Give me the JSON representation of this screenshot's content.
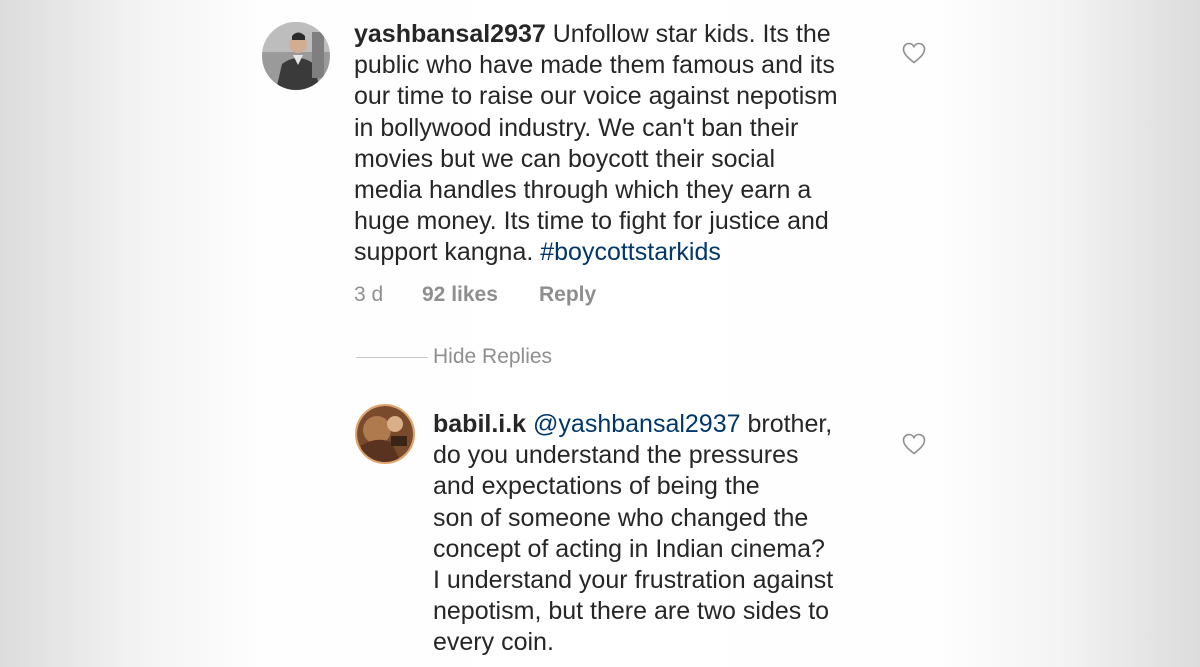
{
  "comment": {
    "username": "yashbansal2937",
    "lines": [
      " Unfollow star kids. Its the",
      "public who have made them famous and its",
      "our time to raise our voice against nepotism",
      "in bollywood industry. We can't ban their",
      "movies but we can boycott their social",
      "media handles through which they earn a",
      "huge money. Its time to fight for justice and"
    ],
    "last_line_text": "support kangna. ",
    "hashtag": "#boycottstarkids",
    "time": "3 d",
    "likes": "92 likes",
    "reply_label": "Reply",
    "avatar_icon": "user-avatar-photo",
    "like_icon": "heart-outline-icon"
  },
  "replies_toggle": {
    "label": "Hide Replies"
  },
  "reply": {
    "username": "babil.i.k",
    "mention": "@yashbansal2937",
    "first_line_rest": " brother,",
    "lines": [
      "do you understand the pressures",
      "and expectations of being the",
      "son of someone who changed the",
      "concept of acting in Indian cinema?",
      "I understand your frustration against",
      "nepotism, but there are two sides to",
      "every coin."
    ],
    "avatar_icon": "user-avatar-photo",
    "like_icon": "heart-outline-icon"
  },
  "colors": {
    "text": "#262626",
    "secondary": "#8e8e8e",
    "link": "#00376b"
  }
}
